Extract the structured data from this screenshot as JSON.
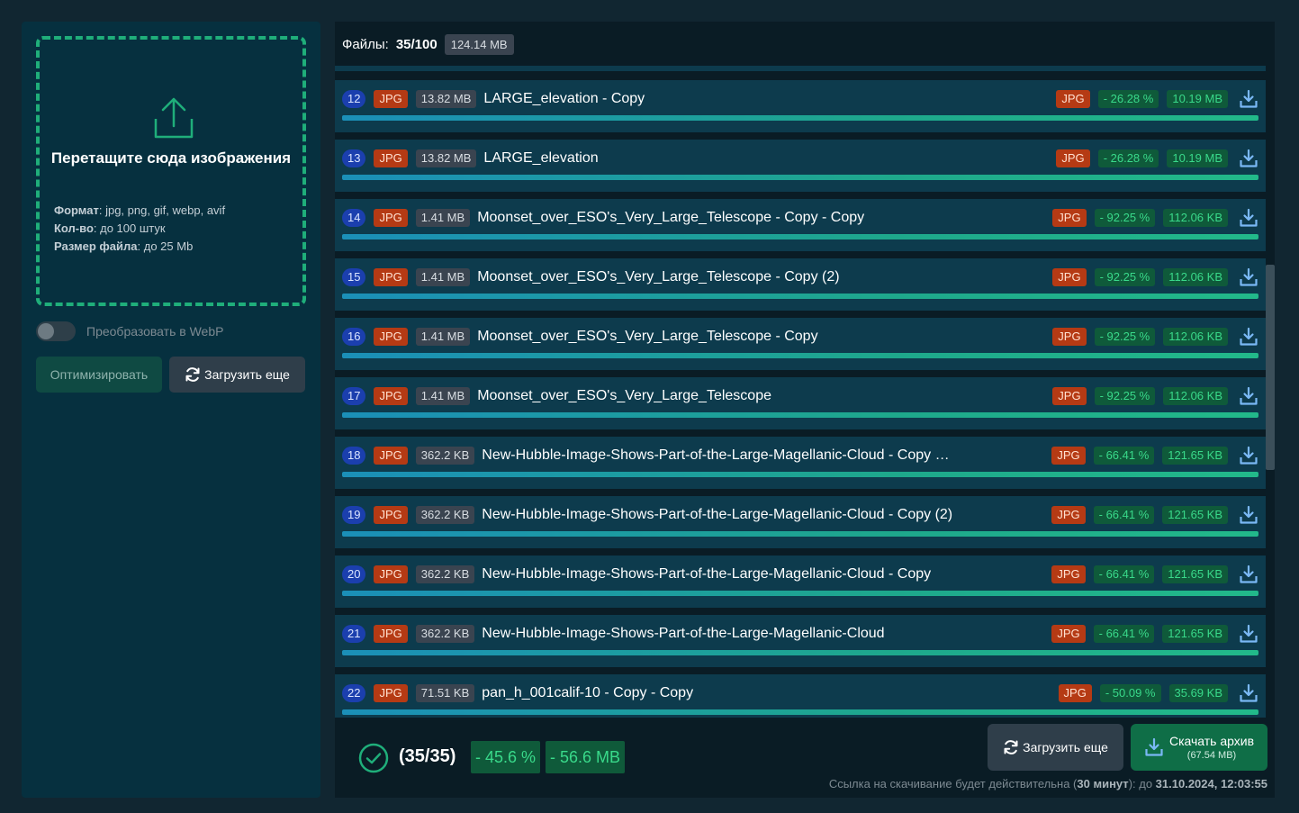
{
  "sidebar": {
    "drop_title": "Перетащите сюда изображения",
    "format_label": "Формат",
    "format_value": ": jpg, png, gif, webp, avif",
    "count_label": "Кол-во",
    "count_value": ": до 100 штук",
    "size_label": "Размер файла",
    "size_value": ": до 25 Mb",
    "webp_toggle_label": "Преобразовать в WebP",
    "webp_toggle_on": false,
    "optimize_button": "Оптимизировать",
    "upload_more_button": "Загрузить еще"
  },
  "header": {
    "files_label": "Файлы:",
    "files_count": "35/100",
    "total_size": "124.14 MB"
  },
  "files": [
    {
      "num": "12",
      "format": "JPG",
      "size": "13.82 MB",
      "name": "LARGE_elevation - Copy",
      "out_format": "JPG",
      "saving": "- 26.28 %",
      "out_size": "10.19 MB"
    },
    {
      "num": "13",
      "format": "JPG",
      "size": "13.82 MB",
      "name": "LARGE_elevation",
      "out_format": "JPG",
      "saving": "- 26.28 %",
      "out_size": "10.19 MB"
    },
    {
      "num": "14",
      "format": "JPG",
      "size": "1.41 MB",
      "name": "Moonset_over_ESO's_Very_Large_Telescope - Copy - Copy",
      "out_format": "JPG",
      "saving": "- 92.25 %",
      "out_size": "112.06 KB"
    },
    {
      "num": "15",
      "format": "JPG",
      "size": "1.41 MB",
      "name": "Moonset_over_ESO's_Very_Large_Telescope - Copy (2)",
      "out_format": "JPG",
      "saving": "- 92.25 %",
      "out_size": "112.06 KB"
    },
    {
      "num": "16",
      "format": "JPG",
      "size": "1.41 MB",
      "name": "Moonset_over_ESO's_Very_Large_Telescope - Copy",
      "out_format": "JPG",
      "saving": "- 92.25 %",
      "out_size": "112.06 KB"
    },
    {
      "num": "17",
      "format": "JPG",
      "size": "1.41 MB",
      "name": "Moonset_over_ESO's_Very_Large_Telescope",
      "out_format": "JPG",
      "saving": "- 92.25 %",
      "out_size": "112.06 KB"
    },
    {
      "num": "18",
      "format": "JPG",
      "size": "362.2 KB",
      "name": "New-Hubble-Image-Shows-Part-of-the-Large-Magellanic-Cloud - Copy …",
      "out_format": "JPG",
      "saving": "- 66.41 %",
      "out_size": "121.65 KB"
    },
    {
      "num": "19",
      "format": "JPG",
      "size": "362.2 KB",
      "name": "New-Hubble-Image-Shows-Part-of-the-Large-Magellanic-Cloud - Copy (2)",
      "out_format": "JPG",
      "saving": "- 66.41 %",
      "out_size": "121.65 KB"
    },
    {
      "num": "20",
      "format": "JPG",
      "size": "362.2 KB",
      "name": "New-Hubble-Image-Shows-Part-of-the-Large-Magellanic-Cloud - Copy",
      "out_format": "JPG",
      "saving": "- 66.41 %",
      "out_size": "121.65 KB"
    },
    {
      "num": "21",
      "format": "JPG",
      "size": "362.2 KB",
      "name": "New-Hubble-Image-Shows-Part-of-the-Large-Magellanic-Cloud",
      "out_format": "JPG",
      "saving": "- 66.41 %",
      "out_size": "121.65 KB"
    },
    {
      "num": "22",
      "format": "JPG",
      "size": "71.51 KB",
      "name": "pan_h_001calif-10 - Copy - Copy",
      "out_format": "JPG",
      "saving": "- 50.09 %",
      "out_size": "35.69 KB"
    }
  ],
  "footer": {
    "done_count": "(35/35)",
    "total_saving_pct": "- 45.6 %",
    "total_saving_mb": "- 56.6 MB",
    "upload_more_button": "Загрузить еще",
    "archive_button": "Скачать архив",
    "archive_size": "(67.54 MB)",
    "note_prefix": "Ссылка на скачивание будет действительна (",
    "note_duration": "30 минут",
    "note_middle": "): до ",
    "note_date": "31.10.2024, 12:03:55"
  },
  "colors": {
    "accent_green": "#1fae7a",
    "badge_format": "#b53a14",
    "badge_number": "#1b3fae",
    "saving_text": "#39d98a",
    "download_icon": "#7ab8f5"
  }
}
